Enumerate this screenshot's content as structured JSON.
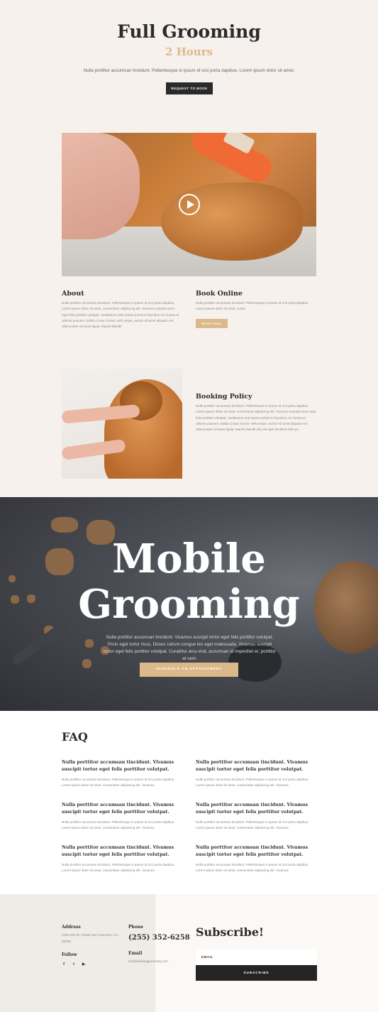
{
  "hero": {
    "title": "Full Grooming",
    "subtitle": "2 Hours",
    "description": "Nulla porttitor accumsan tincidunt. Pellentesque in ipsum id orci porta dapibus. Lorem ipsum dolor sit amet,",
    "button": "REQUEST TO BOOK"
  },
  "about": {
    "title": "About",
    "text": "Nulla porttitor accumsan tincidunt. Pellentesque in ipsum id orci porta dapibus. Lorem ipsum dolor sit amet, consectetur adipiscing elit. Vivamus suscipit tortor eget felis porttitor volutpat. Vestibulum ante ipsum primis in faucibus orci luctus et ultrices posuere cubilia Curae; Donec velit neque, auctor sit amet aliquam vel, ullamcorper sit amet ligula. Mauris blandit"
  },
  "book_online": {
    "title": "Book Online",
    "text": "Nulla porttitor accumsan tincidunt. Pellentesque in ipsum id orci porta dapibus. Lorem ipsum dolor sit amet, conse",
    "button": "BOOK NOW"
  },
  "booking_policy": {
    "title": "Booking Policy",
    "text": "Nulla porttitor accumsan tincidunt. Pellentesque in ipsum id orci porta dapibus. Lorem ipsum dolor sit amet, consectetur adipiscing elit. Vivamus suscipit tortor eget felis porttitor volutpat. Vestibulum ante ipsum primis in faucibus orci luctus et ultrices posuere cubilia Curae; Donec velit neque, auctor sit amet aliquam vel, ullamcorper sit amet ligula. Mauris blandit aliq elit eget tincidunt nibh pu"
  },
  "mobile": {
    "title_line1": "Mobile",
    "title_line2": "Grooming",
    "description": "Nulla porttitor accumsan tincidunt. Vivamus suscipit tortor eget felis porttitor volutpat. Proin eget tortor risus. Donec rutrum congue leo eget malesuada. Vivamus suscipit tortor eget felis porttitor volutpat. Curabitur arcu erat, accumsan id imperdiet et, porttitor at sem.",
    "button": "SCHEDULE AN APPOINTMENT"
  },
  "faq": {
    "title": "FAQ",
    "items": [
      {
        "question": "Nulla porttitor accumsan tincidunt. Vivamus suscipit tortor eget felis porttitor volutpat.",
        "answer": "Nulla porttitor accumsan tincidunt. Pellentesque in ipsum id orci porta dapibus. Lorem ipsum dolor sit amet, consectetur adipiscing elit. Vivamus"
      },
      {
        "question": "Nulla porttitor accumsan tincidunt. Vivamus suscipit tortor eget felis porttitor volutpat.",
        "answer": "Nulla porttitor accumsan tincidunt. Pellentesque in ipsum id orci porta dapibus. Lorem ipsum dolor sit amet, consectetur adipiscing elit. Vivamus"
      },
      {
        "question": "Nulla porttitor accumsan tincidunt. Vivamus suscipit tortor eget felis porttitor volutpat.",
        "answer": "Nulla porttitor accumsan tincidunt. Pellentesque in ipsum id orci porta dapibus. Lorem ipsum dolor sit amet, consectetur adipiscing elit. Vivamus"
      },
      {
        "question": "Nulla porttitor accumsan tincidunt. Vivamus suscipit tortor eget felis porttitor volutpat.",
        "answer": "Nulla porttitor accumsan tincidunt. Pellentesque in ipsum id orci porta dapibus. Lorem ipsum dolor sit amet, consectetur adipiscing elit. Vivamus"
      },
      {
        "question": "Nulla porttitor accumsan tincidunt. Vivamus suscipit tortor eget felis porttitor volutpat.",
        "answer": "Nulla porttitor accumsan tincidunt. Pellentesque in ipsum id orci porta dapibus. Lorem ipsum dolor sit amet, consectetur adipiscing elit. Vivamus"
      },
      {
        "question": "Nulla porttitor accumsan tincidunt. Vivamus suscipit tortor eget felis porttitor volutpat.",
        "answer": "Nulla porttitor accumsan tincidunt. Pellentesque in ipsum id orci porta dapibus. Lorem ipsum dolor sit amet, consectetur adipiscing elit. Vivamus"
      }
    ]
  },
  "footer": {
    "address_label": "Address",
    "address": "1234 Divi St. #1000 San Francisco, CA 93945",
    "follow_label": "Follow",
    "social": [
      "f",
      "t",
      "▶"
    ],
    "phone_label": "Phone",
    "phone": "(255) 352-6258",
    "email_label": "Email",
    "email": "info@dividoggrooming.com",
    "subscribe_title": "Subscribe!",
    "email_placeholder": "EMAIL",
    "subscribe_button": "SUBSCRIBE"
  },
  "colors": {
    "background": "#f6f1ed",
    "accent": "#dcb98a",
    "dark": "#2a2a2a"
  }
}
